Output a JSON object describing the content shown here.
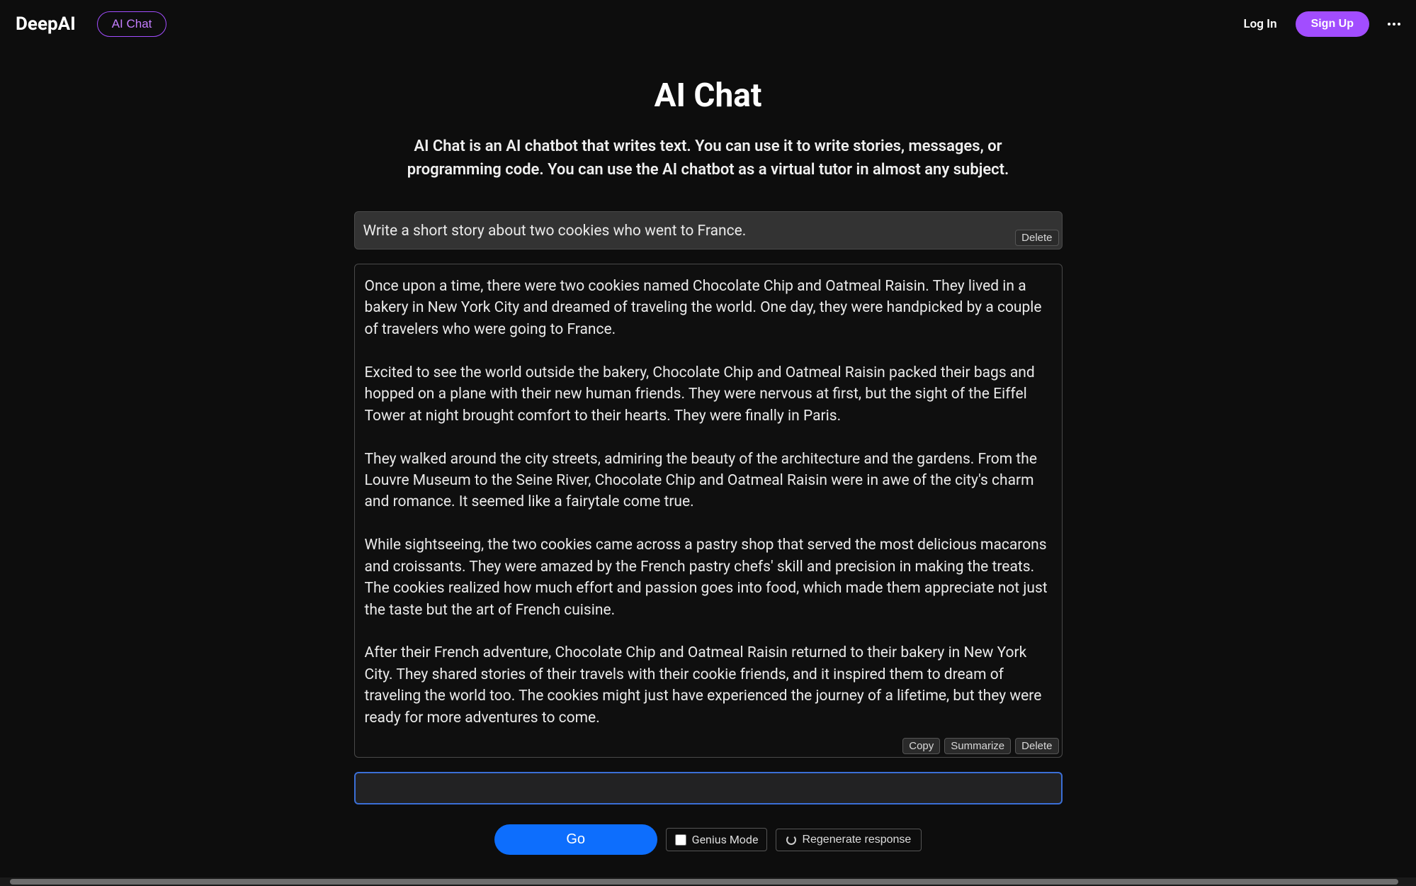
{
  "header": {
    "logo": "DeepAI",
    "nav_pill": "AI Chat",
    "login": "Log In",
    "signup": "Sign Up"
  },
  "page": {
    "title": "AI Chat",
    "description": "AI Chat is an AI chatbot that writes text. You can use it to write stories, messages, or programming code. You can use the AI chatbot as a virtual tutor in almost any subject."
  },
  "chat": {
    "prompt": "Write a short story about two cookies who went to France.",
    "response": "Once upon a time, there were two cookies named Chocolate Chip and Oatmeal Raisin. They lived in a bakery in New York City and dreamed of traveling the world. One day, they were handpicked by a couple of travelers who were going to France.\n\nExcited to see the world outside the bakery, Chocolate Chip and Oatmeal Raisin packed their bags and hopped on a plane with their new human friends. They were nervous at first, but the sight of the Eiffel Tower at night brought comfort to their hearts. They were finally in Paris.\n\nThey walked around the city streets, admiring the beauty of the architecture and the gardens. From the Louvre Museum to the Seine River, Chocolate Chip and Oatmeal Raisin were in awe of the city's charm and romance. It seemed like a fairytale come true.\n\nWhile sightseeing, the two cookies came across a pastry shop that served the most delicious macarons and croissants. They were amazed by the French pastry chefs' skill and precision in making the treats. The cookies realized how much effort and passion goes into food, which made them appreciate not just the taste but the art of French cuisine.\n\nAfter their French adventure, Chocolate Chip and Oatmeal Raisin returned to their bakery in New York City. They shared stories of their travels with their cookie friends, and it inspired them to dream of traveling the world too. The cookies might just have experienced the journey of a lifetime, but they were ready for more adventures to come.",
    "actions": {
      "delete": "Delete",
      "copy": "Copy",
      "summarize": "Summarize"
    },
    "input_value": ""
  },
  "controls": {
    "go": "Go",
    "genius": "Genius Mode",
    "regenerate": "Regenerate response"
  }
}
